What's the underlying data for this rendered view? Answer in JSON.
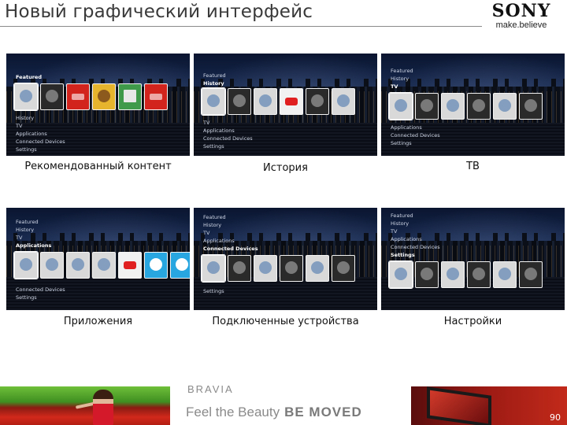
{
  "header": {
    "title": "Новый графический интерфейс",
    "logo_brand": "SONY",
    "logo_tagline": "make.believe"
  },
  "screens": [
    {
      "caption": "Рекомендованный контент",
      "menu": [
        "Featured",
        "History",
        "TV",
        "Applications",
        "Connected Devices",
        "Settings"
      ],
      "selected": "Featured"
    },
    {
      "caption": "История",
      "menu": [
        "Featured",
        "History",
        "TV",
        "Applications",
        "Connected Devices",
        "Settings"
      ],
      "selected": "History"
    },
    {
      "caption": "ТВ",
      "menu": [
        "Featured",
        "History",
        "TV",
        "Applications",
        "Connected Devices",
        "Settings"
      ],
      "selected": "TV"
    },
    {
      "caption": "Приложения",
      "menu": [
        "Featured",
        "History",
        "TV",
        "Applications",
        "Connected Devices",
        "Settings"
      ],
      "selected": "Applications"
    },
    {
      "caption": "Подключенные устройства",
      "menu": [
        "Featured",
        "History",
        "TV",
        "Applications",
        "Connected Devices",
        "Settings"
      ],
      "selected": "Connected Devices"
    },
    {
      "caption": "Настройки",
      "menu": [
        "Featured",
        "History",
        "TV",
        "Applications",
        "Connected Devices",
        "Settings"
      ],
      "selected": "Settings"
    }
  ],
  "footer": {
    "bravia": "BRAVIA",
    "tagline": "Feel the Beauty",
    "tagline_bold": "BE MOVED",
    "page_number": "90"
  },
  "colors": {
    "tile_red": "#d2241c",
    "brand_gray": "#8a8a8a"
  }
}
